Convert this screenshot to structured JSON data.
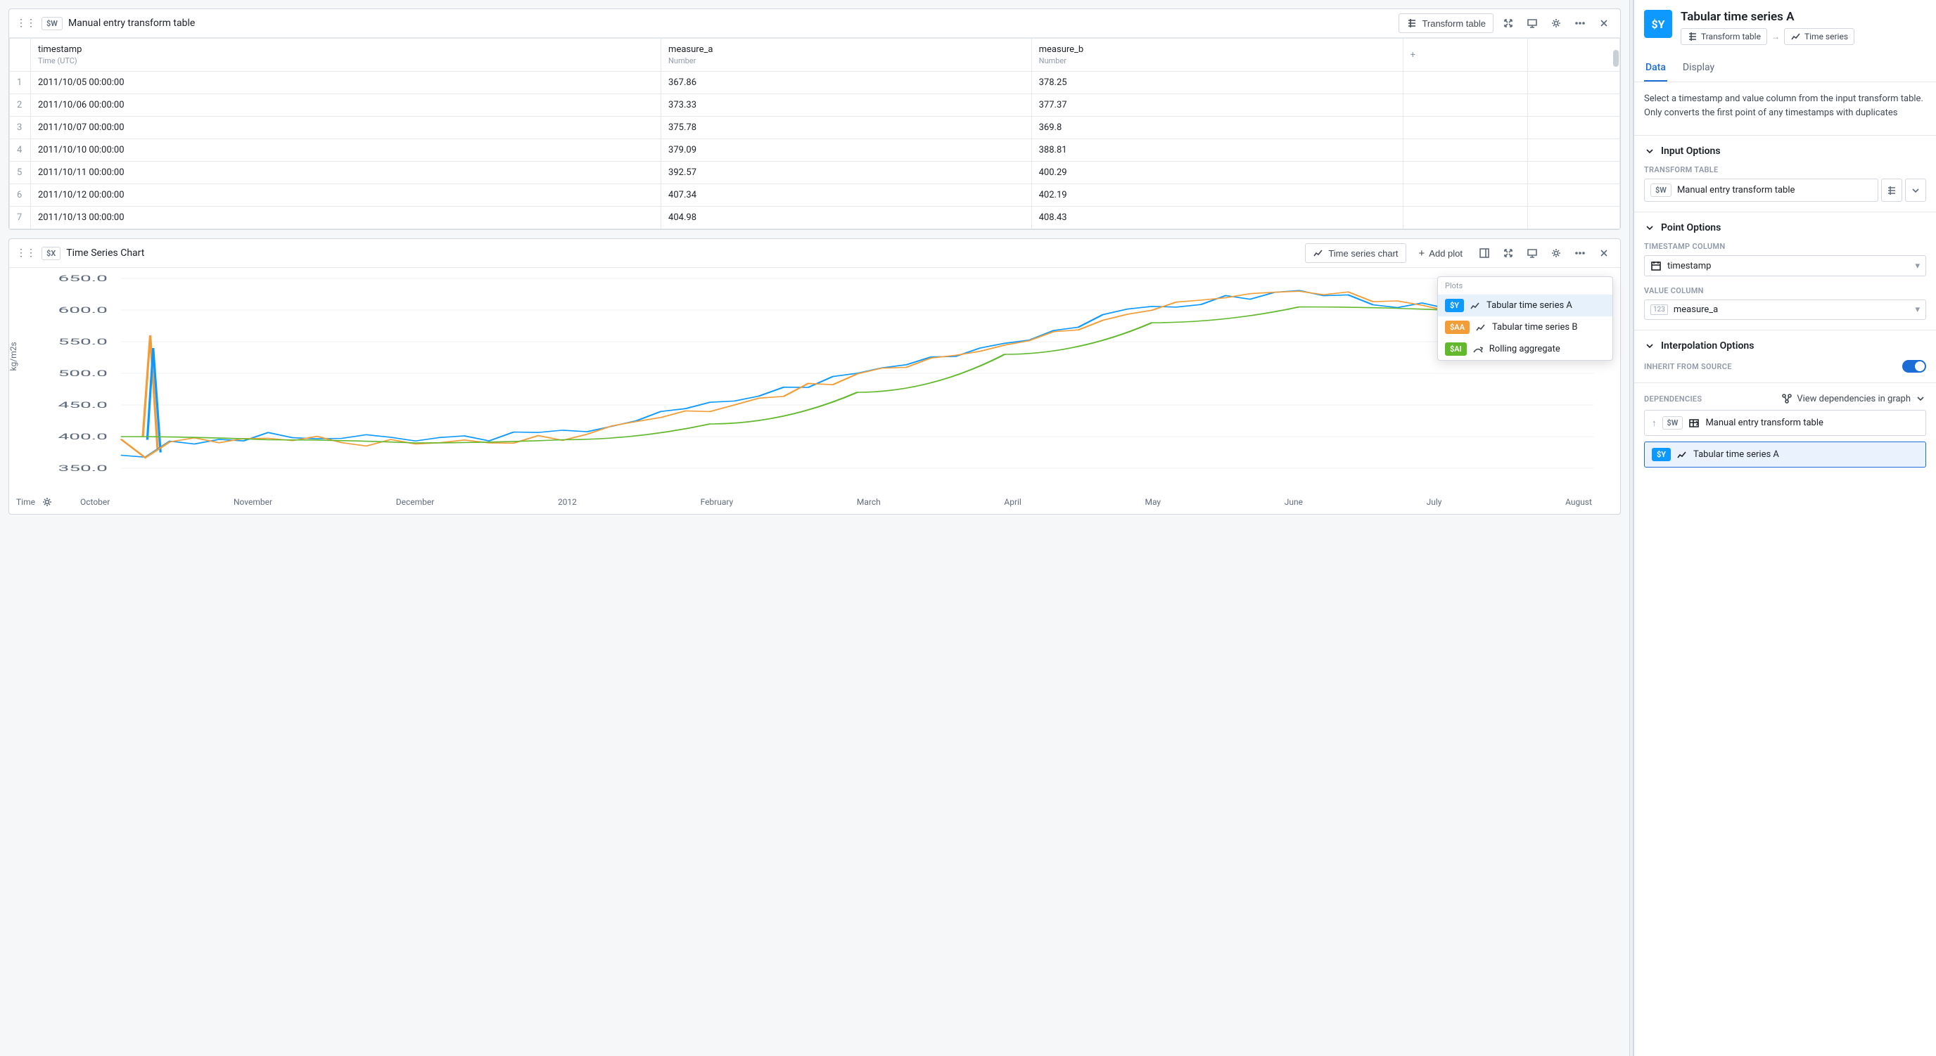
{
  "tablePanel": {
    "badge": "$W",
    "title": "Manual entry transform table",
    "transformBtn": "Transform table",
    "columns": [
      {
        "name": "timestamp",
        "type": "Time (UTC)"
      },
      {
        "name": "measure_a",
        "type": "Number"
      },
      {
        "name": "measure_b",
        "type": "Number"
      }
    ],
    "rows": [
      {
        "n": "1",
        "t": "2011/10/05 00:00:00",
        "a": "367.86",
        "b": "378.25"
      },
      {
        "n": "2",
        "t": "2011/10/06 00:00:00",
        "a": "373.33",
        "b": "377.37"
      },
      {
        "n": "3",
        "t": "2011/10/07 00:00:00",
        "a": "375.78",
        "b": "369.8"
      },
      {
        "n": "4",
        "t": "2011/10/10 00:00:00",
        "a": "379.09",
        "b": "388.81"
      },
      {
        "n": "5",
        "t": "2011/10/11 00:00:00",
        "a": "392.57",
        "b": "400.29"
      },
      {
        "n": "6",
        "t": "2011/10/12 00:00:00",
        "a": "407.34",
        "b": "402.19"
      },
      {
        "n": "7",
        "t": "2011/10/13 00:00:00",
        "a": "404.98",
        "b": "408.43"
      }
    ]
  },
  "chartPanel": {
    "badge": "$X",
    "title": "Time Series Chart",
    "chartTypeBtn": "Time series chart",
    "addPlotBtn": "Add plot",
    "yLabel": "kg/m2s",
    "timeLabel": "Time",
    "plotsTitle": "Plots",
    "plots": [
      {
        "badge": "$Y",
        "badgeClass": "badge-y",
        "name": "Tabular time series A",
        "icon": "line"
      },
      {
        "badge": "$AA",
        "badgeClass": "badge-aa",
        "name": "Tabular time series B",
        "icon": "line"
      },
      {
        "badge": "$AI",
        "badgeClass": "badge-ai",
        "name": "Rolling aggregate",
        "icon": "trend"
      }
    ],
    "xTicks": [
      "October",
      "November",
      "December",
      "2012",
      "February",
      "March",
      "April",
      "May",
      "June",
      "July",
      "August"
    ]
  },
  "chart_data": {
    "type": "line",
    "title": "Time Series Chart",
    "xlabel": "Time",
    "ylabel": "kg/m2s",
    "ylim": [
      350,
      650
    ],
    "x_ticks": [
      "October",
      "November",
      "December",
      "2012",
      "February",
      "March",
      "April",
      "May",
      "June",
      "July",
      "August"
    ],
    "y_ticks": [
      350,
      400,
      450,
      500,
      550,
      600,
      650
    ],
    "categories": [
      0,
      1,
      2,
      3,
      4,
      5,
      6,
      7,
      8,
      9,
      10
    ],
    "series": [
      {
        "name": "Tabular time series A",
        "color": "#0d99ff",
        "values": [
          380,
          400,
          395,
          405,
          450,
          500,
          550,
          605,
          630,
          600,
          595
        ]
      },
      {
        "name": "Tabular time series B",
        "color": "#f29d38",
        "values": [
          390,
          395,
          390,
          400,
          445,
          495,
          545,
          600,
          635,
          595,
          590
        ]
      },
      {
        "name": "Rolling aggregate",
        "color": "#62b92d",
        "values": [
          400,
          395,
          390,
          395,
          420,
          470,
          530,
          580,
          605,
          600,
          590
        ]
      }
    ],
    "note": "Series A and B oscillate closely with an early sharp spike (~560) in October then drop to ~370–380 before rising; Rolling aggregate is a smooth S-curve through them."
  },
  "sidebar": {
    "badge": "$Y",
    "title": "Tabular time series A",
    "breadcrumb": {
      "from": "Transform table",
      "to": "Time series"
    },
    "tabs": [
      "Data",
      "Display"
    ],
    "helpText": "Select a timestamp and value column from the input transform table. Only converts the first point of any timestamps with duplicates",
    "inputOptions": {
      "heading": "Input Options",
      "label": "TRANSFORM TABLE",
      "valueBadge": "$W",
      "value": "Manual entry transform table"
    },
    "pointOptions": {
      "heading": "Point Options",
      "tsLabel": "TIMESTAMP COLUMN",
      "tsValue": "timestamp",
      "valLabel": "VALUE COLUMN",
      "valValue": "measure_a"
    },
    "interp": {
      "heading": "Interpolation Options",
      "inheritLabel": "INHERIT FROM SOURCE"
    },
    "deps": {
      "heading": "DEPENDENCIES",
      "viewBtn": "View dependencies in graph",
      "items": [
        {
          "dir": "up",
          "badge": "$W",
          "badgeClass": "",
          "name": "Manual entry transform table",
          "icon": "table"
        },
        {
          "dir": "self",
          "badge": "$Y",
          "badgeClass": "badge-y",
          "name": "Tabular time series A",
          "icon": "line"
        }
      ]
    }
  }
}
